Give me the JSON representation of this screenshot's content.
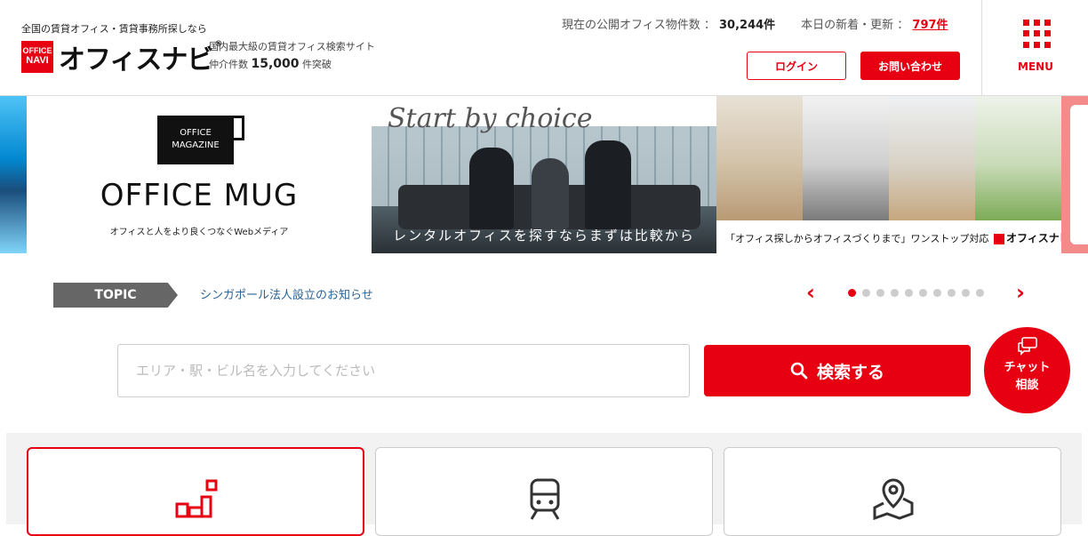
{
  "header": {
    "tagline": "全国の賃貸オフィス・賃貸事務所探しなら",
    "logo_box_line1": "OFFICE",
    "logo_box_line2": "NAVI",
    "logo_text": "オフィスナビ",
    "logo_mark": "®",
    "subtitle": "国内最大級の賃貸オフィス検索サイト",
    "deals_prefix": "仲介件数",
    "deals_count": "15,000",
    "deals_suffix": "件突破",
    "stats_public_label": "現在の公開オフィス物件数 ：",
    "stats_public_count": "30,244件",
    "stats_new_label": "本日の新着・更新 ：",
    "stats_new_count": "797件",
    "login_label": "ログイン",
    "contact_label": "お問い合わせ",
    "menu_label": "MENU"
  },
  "banners": {
    "mug_box_line1": "OFFICE",
    "mug_box_line2": "MAGAZINE",
    "mug_title": "OFFICE MUG",
    "mug_sub": "オフィスと人をより良くつなぐWebメディア",
    "photo_script": "Start by choice",
    "photo_caption": "レンタルオフィスを探すならまずは比較から",
    "rooms_caption": "「オフィス探しからオフィスづくりまで」ワンストップ対応",
    "rooms_logo": "オフィスナビ"
  },
  "topic": {
    "badge": "TOPIC",
    "text": "シンガポール法人設立のお知らせ",
    "prev_icon": "chevron-left-icon",
    "next_icon": "chevron-right-icon",
    "dot_count": 10,
    "active_dot": 0
  },
  "search": {
    "placeholder": "エリア・駅・ビル名を入力してください",
    "button_label": "検索する"
  },
  "chat": {
    "line1": "チャット",
    "line2": "相談"
  },
  "cards": [
    {
      "icon": "office-area-icon",
      "selected": true
    },
    {
      "icon": "train-icon",
      "selected": false
    },
    {
      "icon": "map-pin-icon",
      "selected": false
    }
  ],
  "colors": {
    "brand": "#e60012",
    "topic_badge": "#666666",
    "link": "#2a6496"
  }
}
